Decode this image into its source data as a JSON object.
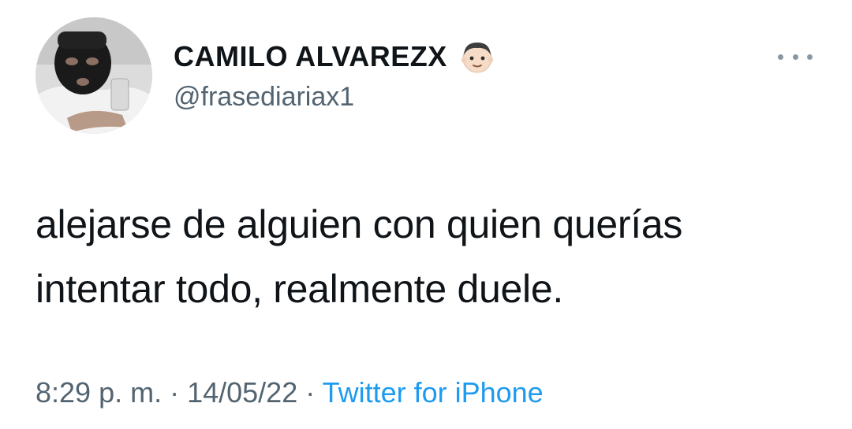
{
  "user": {
    "display_name": "CAMILO ALVAREZX",
    "handle": "@frasediariax1"
  },
  "tweet": {
    "line1": "alejarse de alguien con quien querías",
    "line2": "intentar todo, realmente duele."
  },
  "meta": {
    "time": "8:29 p. m.",
    "separator": " · ",
    "date": "14/05/22",
    "source": "Twitter for iPhone"
  },
  "icons": {
    "more": "more-horizontal-icon",
    "emoji": "boy-face-emoji"
  },
  "colors": {
    "text": "#0f1419",
    "secondary": "#536471",
    "link": "#1d9bf0"
  }
}
